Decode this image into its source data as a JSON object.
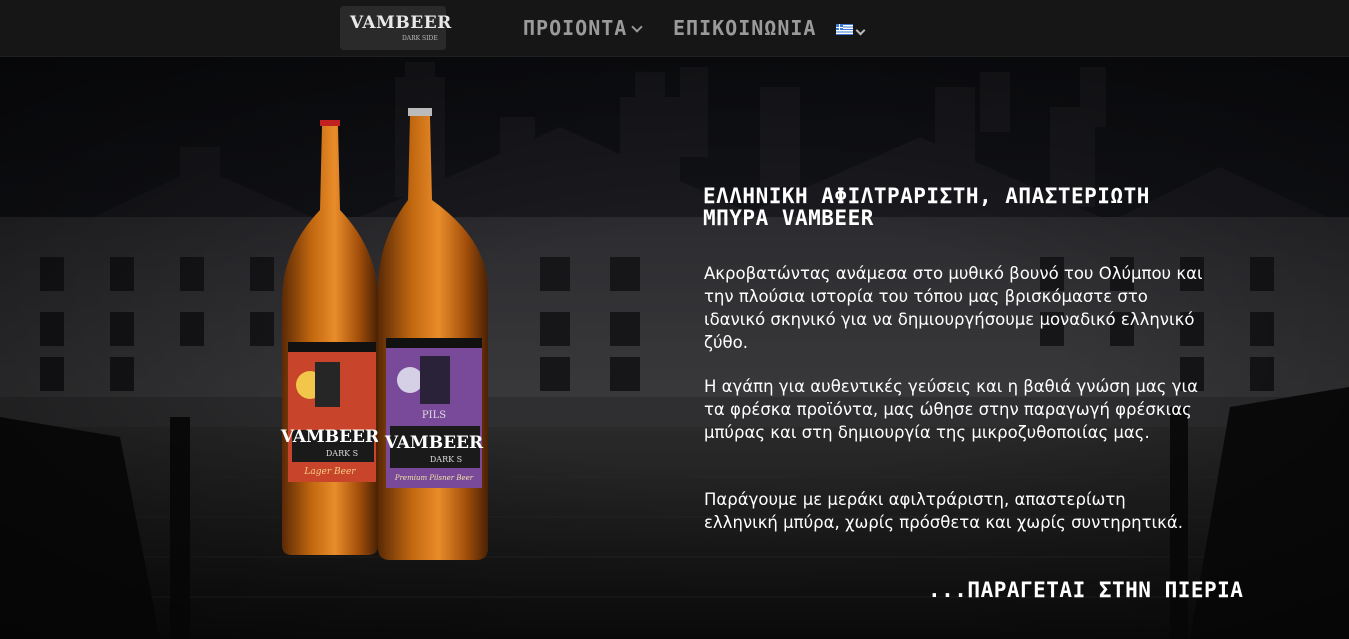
{
  "logo": {
    "main": "VAMBEER",
    "sub": "DARK SIDE"
  },
  "nav": {
    "products_label": "ΠΡΟΙΟΝΤΑ",
    "contact_label": "ΕΠΙΚΟΙΝΩΝΙΑ",
    "language_flag": "greek-flag-icon"
  },
  "hero": {
    "headline": "ΕΛΛΗΝΙΚΗ ΑΦΙΛΤΡΑΡΙΣΤΗ, ΑΠΑΣΤΕΡΙΩΤΗ ΜΠΥΡΑ VAMBEER",
    "paragraphs": [
      "Ακροβατώντας ανάμεσα στο μυθικό βουνό του Ολύμπου και την πλούσια ιστορία του τόπου μας βρισκόμαστε στο ιδανικό σκηνικό για να δημιουργήσουμε μοναδικό ελληνικό ζύθο.",
      "Η αγάπη για αυθεντικές γεύσεις και η βαθιά γνώση μας για τα φρέσκα προϊόντα, μας ώθησε στην παραγωγή φρέσκιας μπύρας και στη δημιουργία της μικροζυθοποιίας μας.",
      "Παράγουμε με μεράκι αφιλτράριστη, απαστερίωτη ελληνική μπύρα, χωρίς πρόσθετα και χωρίς συντηρητικά."
    ],
    "footline": "...ΠΑΡΑΓΕΤΑΙ ΣΤΗΝ ΠΙΕΡΙΑ"
  },
  "bottles": {
    "left": {
      "brand": "VAMBEER",
      "sub": "DARK S",
      "type": "Lager Beer"
    },
    "right": {
      "brand": "VAMBEER",
      "sub": "DARK S",
      "style": "PILS",
      "type": "Premium Pilsner Beer"
    }
  },
  "colors": {
    "navbar": "#161616",
    "nav_text": "#9a9a9a",
    "text": "#ffffff"
  }
}
